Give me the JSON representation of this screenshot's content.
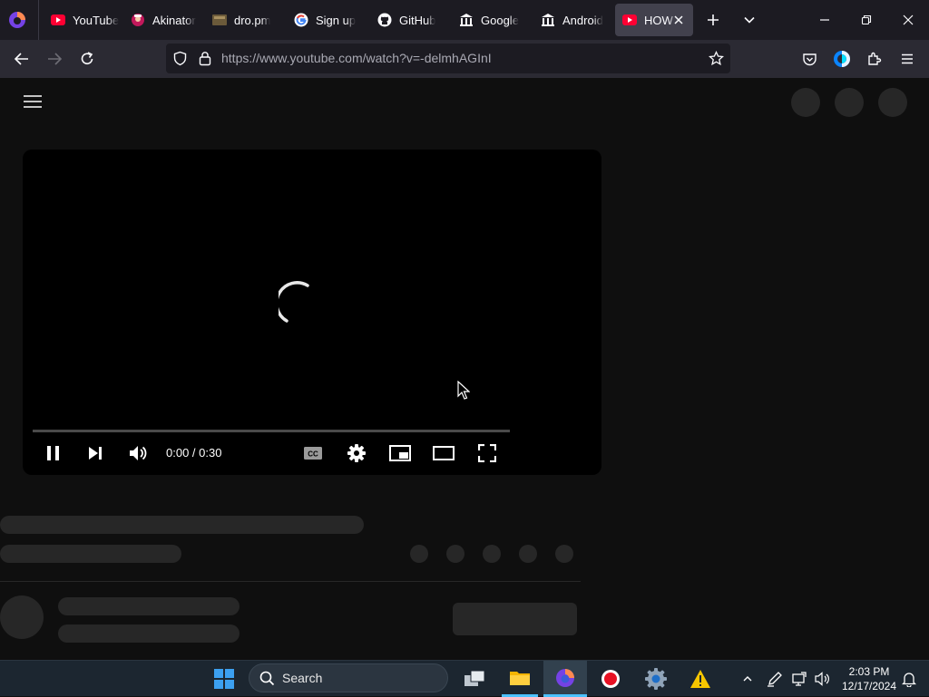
{
  "browser": {
    "tabs": [
      {
        "label": "YouTube",
        "icon": "youtube-icon"
      },
      {
        "label": "Akinator",
        "icon": "akinator-icon"
      },
      {
        "label": "dro.pm",
        "icon": "dropm-icon"
      },
      {
        "label": "Sign up",
        "icon": "google-icon"
      },
      {
        "label": "GitHub",
        "icon": "github-icon"
      },
      {
        "label": "Google",
        "icon": "museum-icon"
      },
      {
        "label": "Android",
        "icon": "museum-icon"
      },
      {
        "label": "HOW",
        "icon": "youtube-icon",
        "active": true
      }
    ],
    "url": "https://www.youtube.com/watch?v=-delmhAGInI",
    "accent_color": "#2b2a33"
  },
  "player": {
    "time": "0:00 / 0:30",
    "state": "loading"
  },
  "taskbar": {
    "search_label": "Search",
    "time": "2:03 PM",
    "date": "12/17/2024"
  }
}
